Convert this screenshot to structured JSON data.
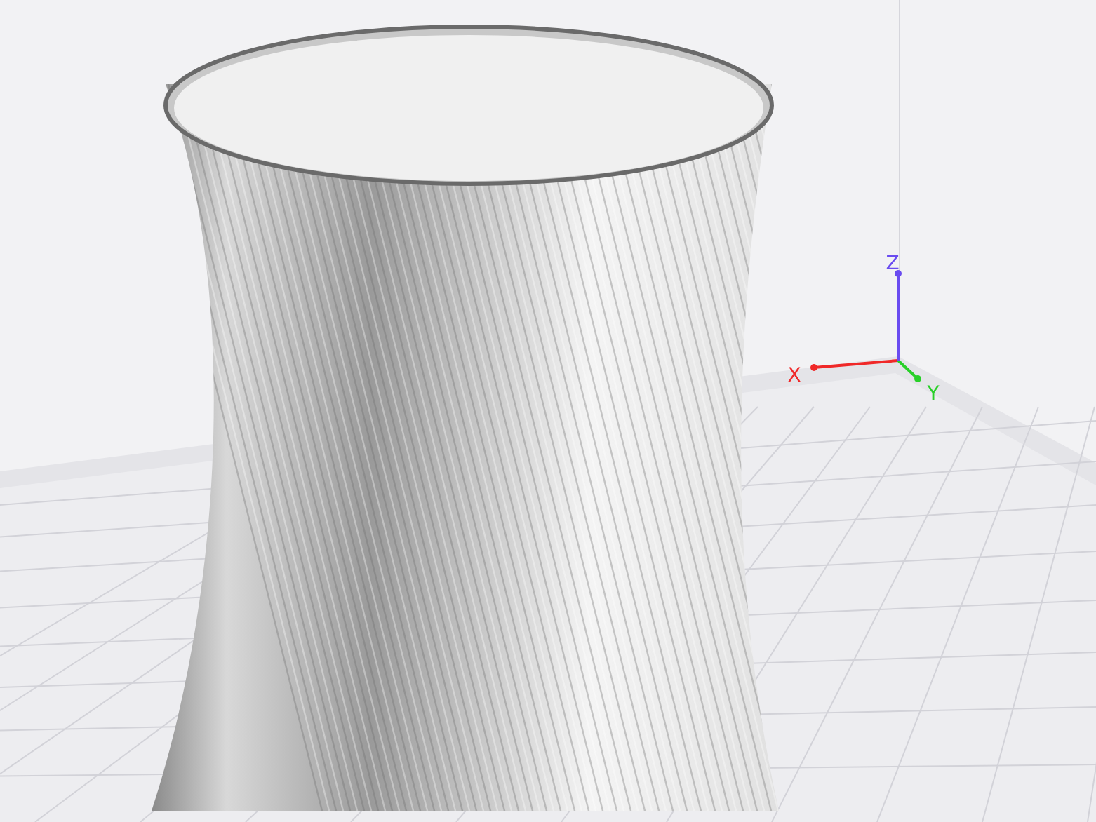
{
  "axes": [
    {
      "label": "X",
      "color": "#f02828"
    },
    {
      "label": "Y",
      "color": "#28d028"
    },
    {
      "label": "Z",
      "color": "#6a4cf0"
    }
  ]
}
